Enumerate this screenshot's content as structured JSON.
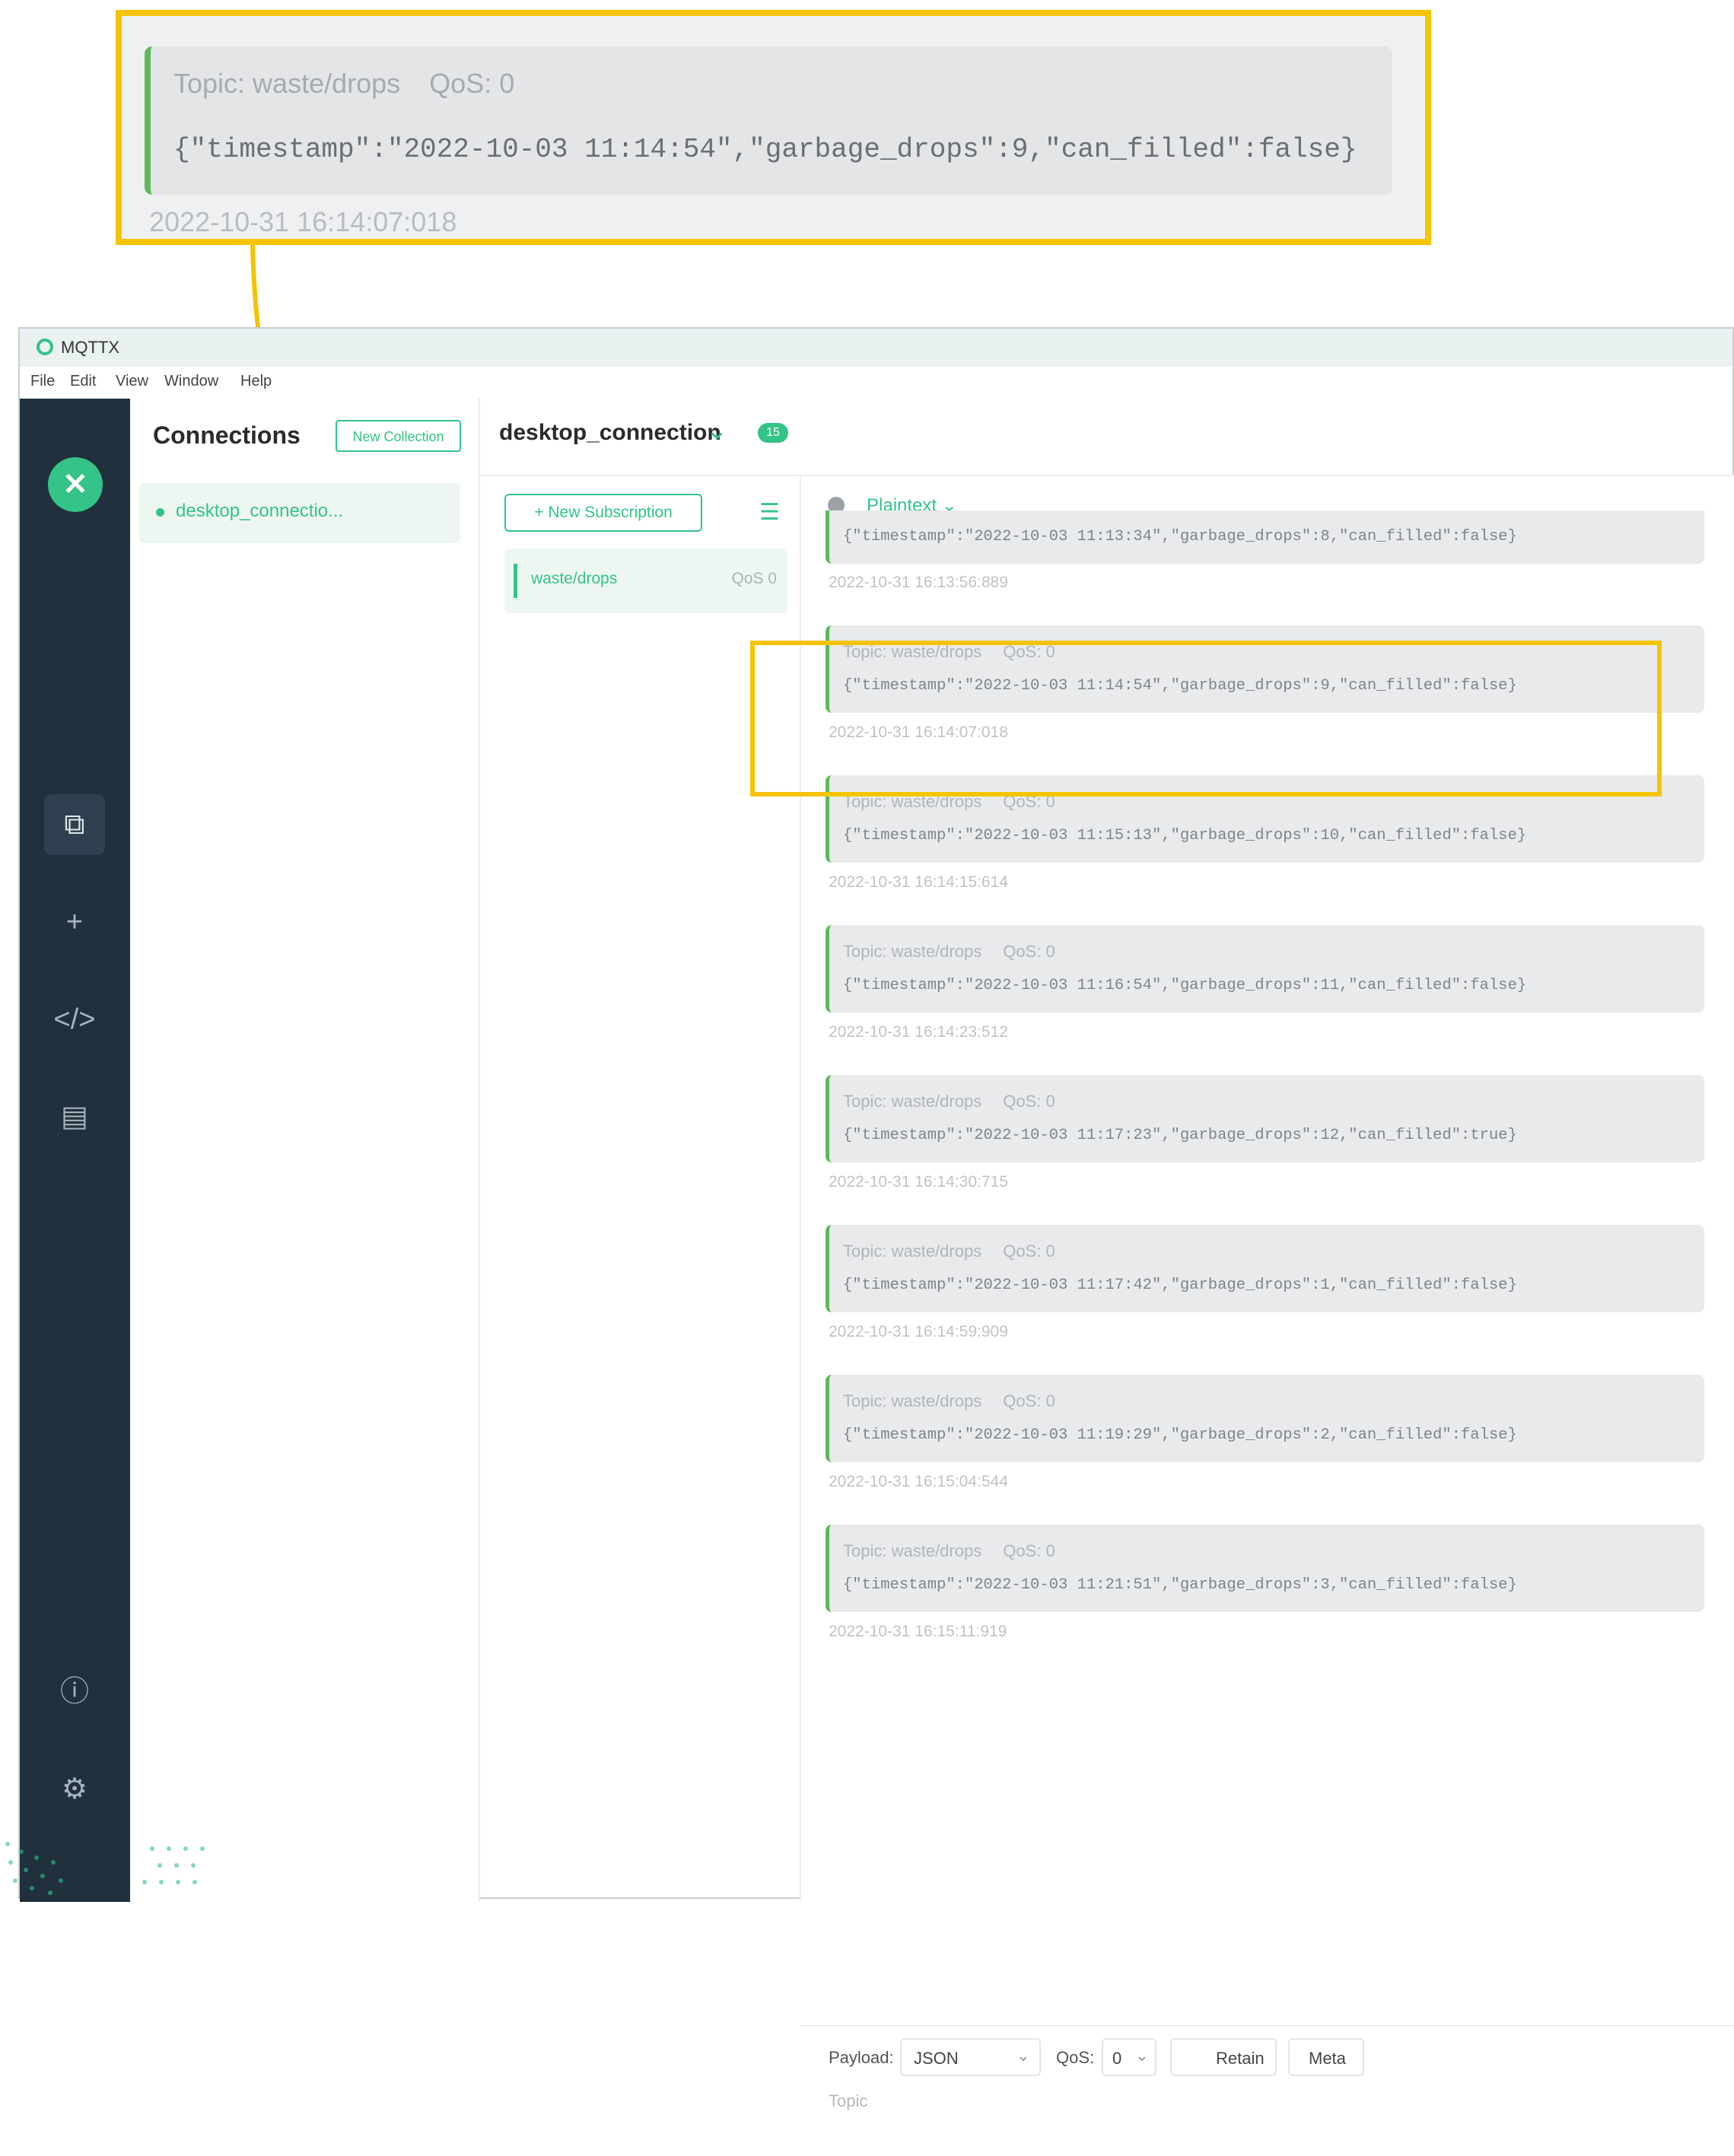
{
  "zoom": {
    "topic": "Topic: waste/drops",
    "qos": "QoS: 0",
    "payload": "{\"timestamp\":\"2022-10-03 11:14:54\",\"garbage_drops\":9,\"can_filled\":false}",
    "timestamp": "2022-10-31 16:14:07:018"
  },
  "window": {
    "title": "MQTTX",
    "menu": [
      "File",
      "Edit",
      "View",
      "Window",
      "Help"
    ]
  },
  "connections": {
    "header": "Connections",
    "new_collection": "New Collection",
    "item": "desktop_connectio..."
  },
  "connection": {
    "name": "desktop_connection",
    "badge": "15"
  },
  "subscriptions": {
    "new_button": "New Subscription",
    "items": [
      {
        "topic": "waste/drops",
        "qos": "QoS 0"
      }
    ]
  },
  "messages": {
    "format": "Plaintext",
    "partial_top": {
      "payload": "{\"timestamp\":\"2022-10-03 11:13:34\",\"garbage_drops\":8,\"can_filled\":false}",
      "timestamp": "2022-10-31 16:13:56:889"
    },
    "items": [
      {
        "topic": "Topic: waste/drops",
        "qos": "QoS: 0",
        "payload": "{\"timestamp\":\"2022-10-03 11:14:54\",\"garbage_drops\":9,\"can_filled\":false}",
        "timestamp": "2022-10-31 16:14:07:018"
      },
      {
        "topic": "Topic: waste/drops",
        "qos": "QoS: 0",
        "payload": "{\"timestamp\":\"2022-10-03 11:15:13\",\"garbage_drops\":10,\"can_filled\":false}",
        "timestamp": "2022-10-31 16:14:15:614"
      },
      {
        "topic": "Topic: waste/drops",
        "qos": "QoS: 0",
        "payload": "{\"timestamp\":\"2022-10-03 11:16:54\",\"garbage_drops\":11,\"can_filled\":false}",
        "timestamp": "2022-10-31 16:14:23:512"
      },
      {
        "topic": "Topic: waste/drops",
        "qos": "QoS: 0",
        "payload": "{\"timestamp\":\"2022-10-03 11:17:23\",\"garbage_drops\":12,\"can_filled\":true}",
        "timestamp": "2022-10-31 16:14:30:715"
      },
      {
        "topic": "Topic: waste/drops",
        "qos": "QoS: 0",
        "payload": "{\"timestamp\":\"2022-10-03 11:17:42\",\"garbage_drops\":1,\"can_filled\":false}",
        "timestamp": "2022-10-31 16:14:59:909"
      },
      {
        "topic": "Topic: waste/drops",
        "qos": "QoS: 0",
        "payload": "{\"timestamp\":\"2022-10-03 11:19:29\",\"garbage_drops\":2,\"can_filled\":false}",
        "timestamp": "2022-10-31 16:15:04:544"
      },
      {
        "topic": "Topic: waste/drops",
        "qos": "QoS: 0",
        "payload": "{\"timestamp\":\"2022-10-03 11:21:51\",\"garbage_drops\":3,\"can_filled\":false}",
        "timestamp": "2022-10-31 16:15:11:919"
      }
    ]
  },
  "publish": {
    "payload_label": "Payload:",
    "payload_format": "JSON",
    "qos_label": "QoS:",
    "qos_value": "0",
    "retain": "Retain",
    "meta": "Meta",
    "topic_placeholder": "Topic"
  },
  "colors": {
    "accent": "#34c388",
    "highlight": "#f5c400",
    "sidebar": "#20303d"
  }
}
